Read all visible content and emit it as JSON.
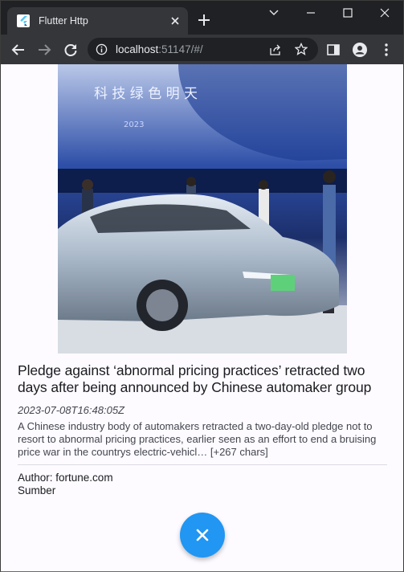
{
  "browser": {
    "tab_title": "Flutter Http",
    "url_host": "localhost",
    "url_rest": ":51147/#/"
  },
  "article": {
    "title": "Pledge against ‘abnormal pricing practices’ retracted two days after being announced by Chinese automaker group",
    "published_at": "2023-07-08T16:48:05Z",
    "description": "A Chinese industry body of automakers retracted a two-day-old pledge not to resort to abnormal pricing practices, earlier seen as an effort to end a bruising price war in the countrys electric-vehicl… [+267 chars]",
    "author_line": "Author: fortune.com",
    "source_line": "Sumber",
    "image_banner_text": "科 技   绿 色   明 天",
    "image_banner_year": "2023"
  },
  "colors": {
    "fab": "#2196f3",
    "page_bg": "#fdfbff",
    "chrome_dark": "#202124",
    "toolbar": "#35363a"
  },
  "icons": {
    "fab": "close-icon",
    "favicon": "flutter-logo-icon"
  }
}
